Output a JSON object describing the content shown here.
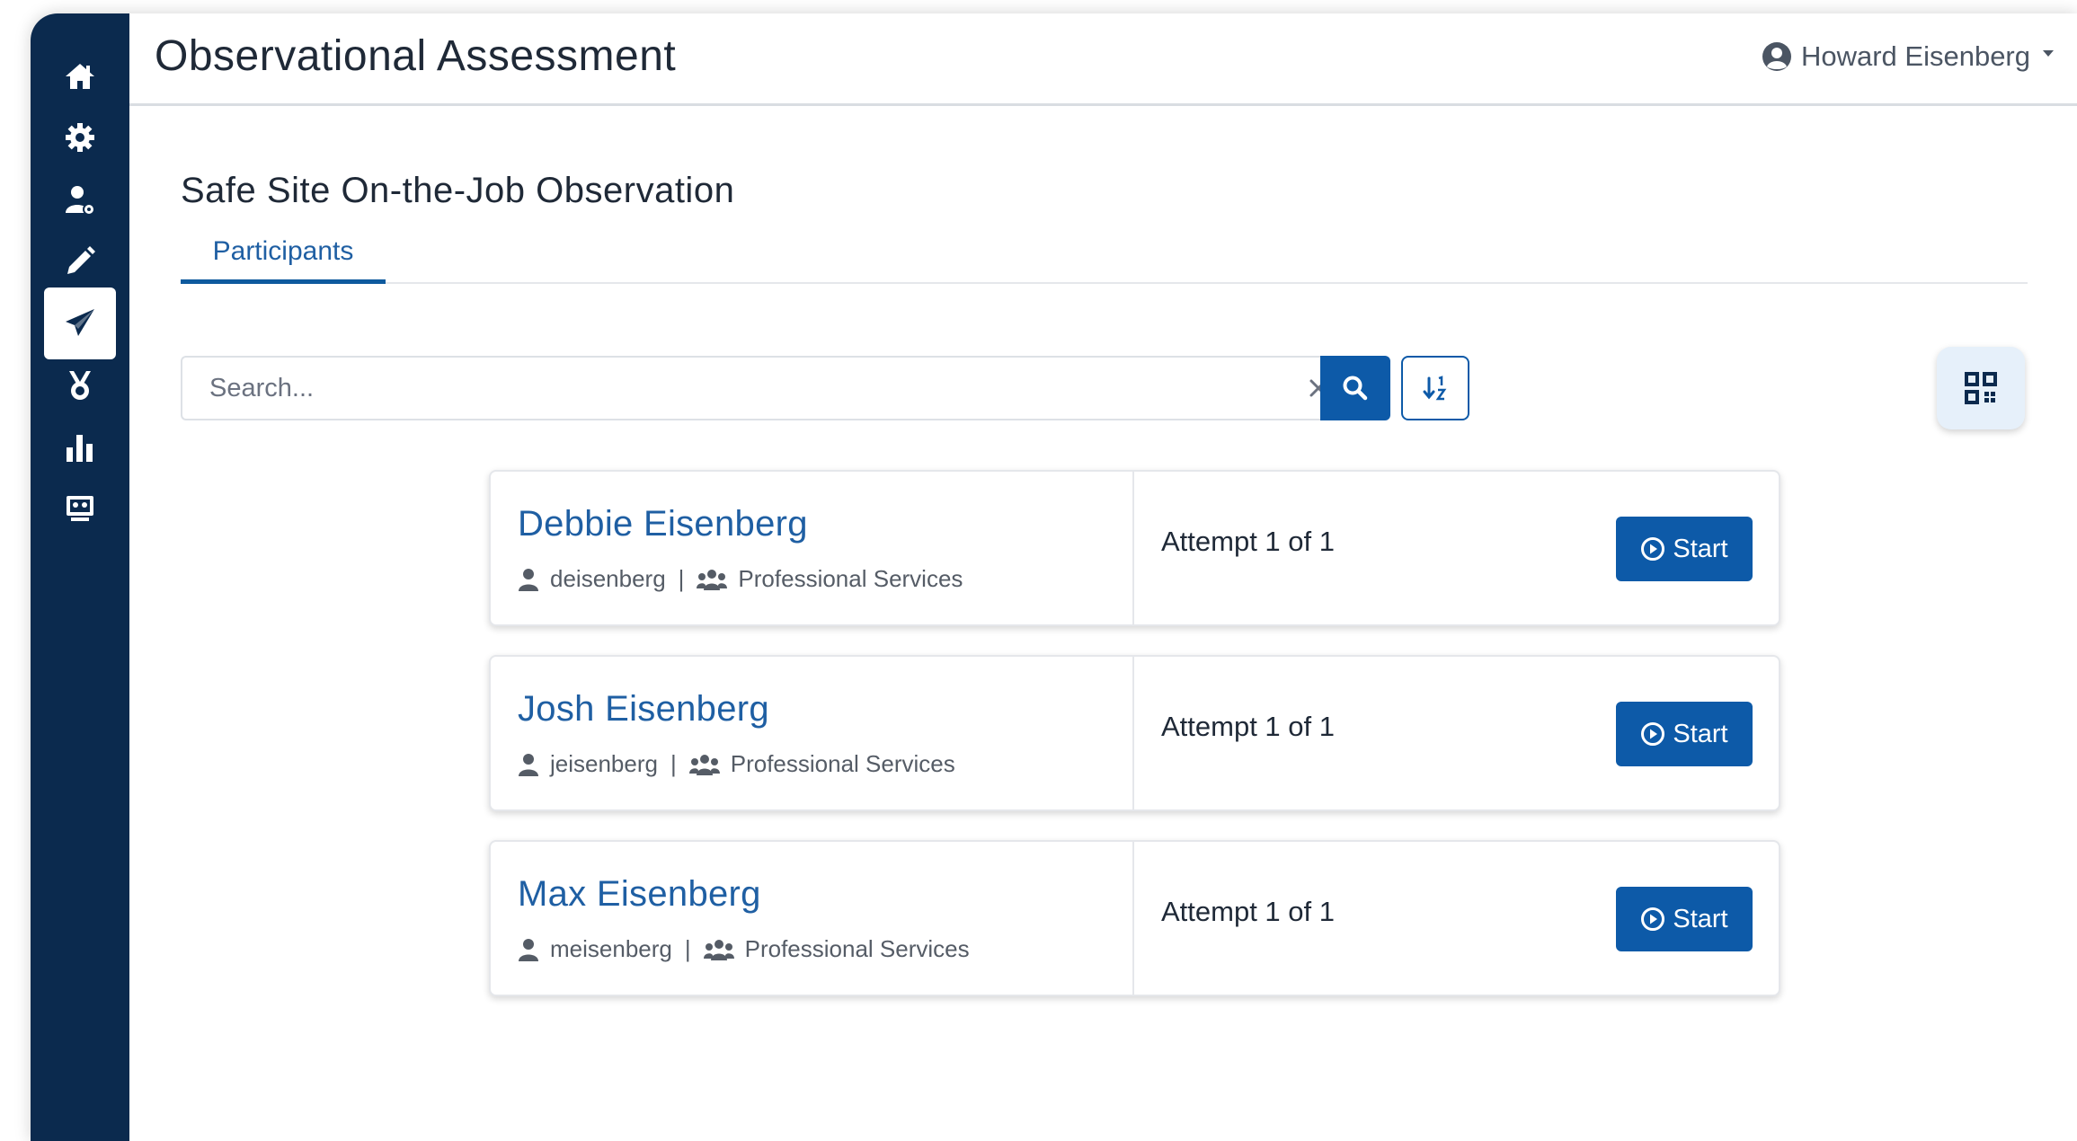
{
  "header": {
    "title": "Observational Assessment",
    "user_name": "Howard Eisenberg"
  },
  "sidebar": {
    "items": [
      {
        "icon": "home-icon"
      },
      {
        "icon": "gear-icon"
      },
      {
        "icon": "user-settings-icon"
      },
      {
        "icon": "pencil-icon"
      },
      {
        "icon": "paper-plane-icon",
        "active": true
      },
      {
        "icon": "award-ribbon-icon"
      },
      {
        "icon": "bar-chart-icon"
      },
      {
        "icon": "classroom-icon"
      }
    ]
  },
  "page": {
    "subtitle": "Safe Site On-the-Job Observation",
    "tabs": [
      {
        "label": "Participants",
        "active": true
      }
    ]
  },
  "search": {
    "placeholder": "Search...",
    "value": ""
  },
  "participants": [
    {
      "name": "Debbie Eisenberg",
      "username": "deisenberg",
      "group": "Professional Services",
      "attempt": "Attempt 1 of 1",
      "action": "Start"
    },
    {
      "name": "Josh Eisenberg",
      "username": "jeisenberg",
      "group": "Professional Services",
      "attempt": "Attempt 1 of 1",
      "action": "Start"
    },
    {
      "name": "Max Eisenberg",
      "username": "meisenberg",
      "group": "Professional Services",
      "attempt": "Attempt 1 of 1",
      "action": "Start"
    }
  ],
  "colors": {
    "sidebar": "#0b2a4e",
    "primary": "#0d5aa8",
    "link": "#1f5fa3"
  }
}
